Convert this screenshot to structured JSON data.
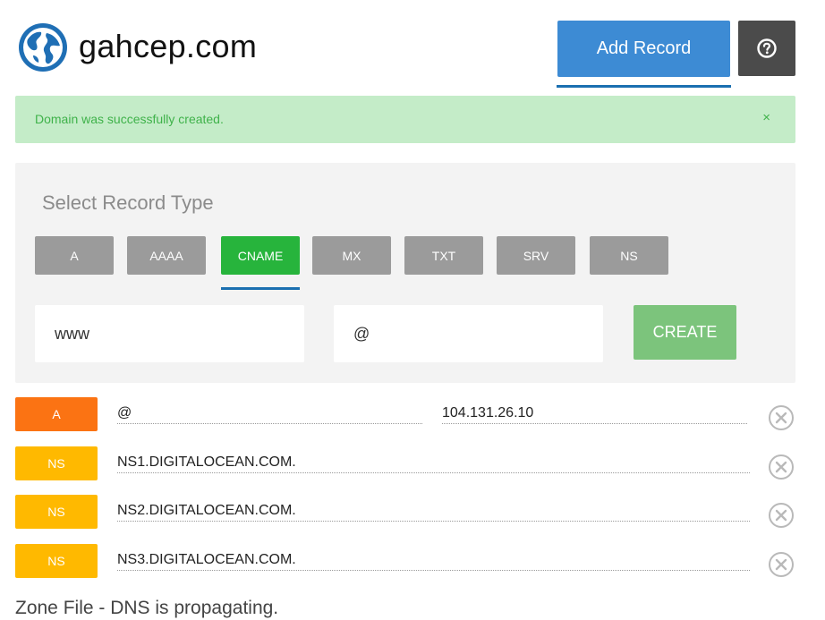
{
  "header": {
    "domain": "gahcep.com",
    "add_record_label": "Add Record",
    "help_icon": "question-circle-icon",
    "globe_icon": "globe-icon"
  },
  "alert": {
    "message": "Domain was successfully created.",
    "close_label": "×"
  },
  "record_form": {
    "title": "Select Record Type",
    "types": [
      {
        "label": "A",
        "active": false
      },
      {
        "label": "AAAA",
        "active": false
      },
      {
        "label": "CNAME",
        "active": true
      },
      {
        "label": "MX",
        "active": false
      },
      {
        "label": "TXT",
        "active": false
      },
      {
        "label": "SRV",
        "active": false
      },
      {
        "label": "NS",
        "active": false
      }
    ],
    "name_value": "www",
    "hostname_value": "@",
    "create_label": "CREATE"
  },
  "records": [
    {
      "type": "A",
      "name": "@",
      "value": "104.131.26.10"
    },
    {
      "type": "NS",
      "value": "NS1.DIGITALOCEAN.COM."
    },
    {
      "type": "NS",
      "value": "NS2.DIGITALOCEAN.COM."
    },
    {
      "type": "NS",
      "value": "NS3.DIGITALOCEAN.COM."
    }
  ],
  "footer": {
    "zone_text": "Zone File - DNS is propagating."
  },
  "colors": {
    "primary": "#3d8bd4",
    "success": "#27b43c",
    "a_badge": "#fb7313",
    "ns_badge": "#ffb900",
    "alert_bg": "#c4ecc8"
  }
}
